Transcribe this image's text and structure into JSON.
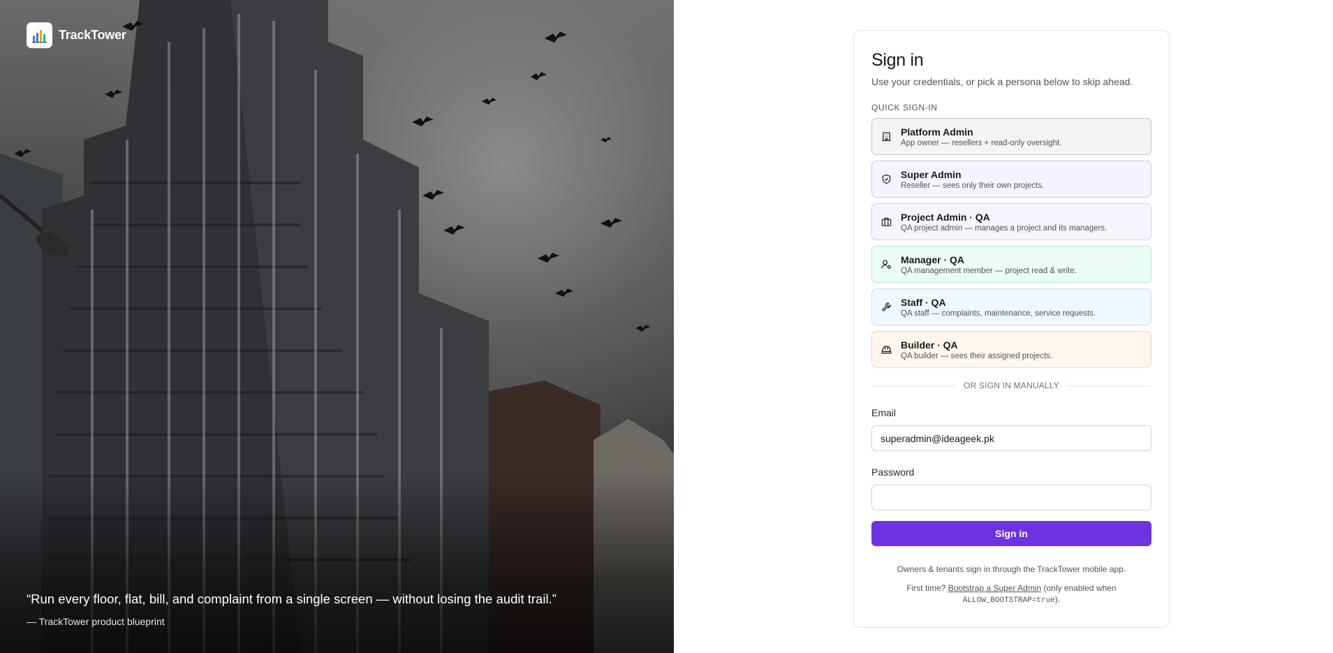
{
  "brand": {
    "name": "TrackTower",
    "logo_icon": "bar-chart-icon"
  },
  "hero": {
    "quote": "“Run every floor, flat, bill, and complaint from a single screen — without losing the audit trail.”",
    "attribution": "— TrackTower product blueprint"
  },
  "signin": {
    "title": "Sign in",
    "subtitle": "Use your credentials, or pick a persona below to skip ahead.",
    "quick_label": "QUICK SIGN-IN",
    "personas": [
      {
        "title": "Platform Admin",
        "desc": "App owner — resellers + read-only oversight.",
        "icon": "building-icon"
      },
      {
        "title": "Super Admin",
        "desc": "Reseller — sees only their own projects.",
        "icon": "shield-check-icon"
      },
      {
        "title": "Project Admin · QA",
        "desc": "QA project admin — manages a project and its managers.",
        "icon": "briefcase-icon"
      },
      {
        "title": "Manager · QA",
        "desc": "QA management member — project read & write.",
        "icon": "user-cog-icon"
      },
      {
        "title": "Staff · QA",
        "desc": "QA staff — complaints, maintenance, service requests.",
        "icon": "wrench-icon"
      },
      {
        "title": "Builder · QA",
        "desc": "QA builder — sees their assigned projects.",
        "icon": "hard-hat-icon"
      }
    ],
    "divider_text": "OR SIGN IN MANUALLY",
    "email_label": "Email",
    "email_value": "superadmin@ideageek.pk",
    "password_label": "Password",
    "password_value": "",
    "submit_label": "Sign in",
    "footnote": "Owners & tenants sign in through the TrackTower mobile app.",
    "first_time_prefix": "First time?",
    "bootstrap_link": "Bootstrap a Super Admin",
    "first_time_mid": "(only enabled when",
    "bootstrap_flag": "ALLOW_BOOTSTRAP=true",
    "first_time_suffix": ")."
  },
  "colors": {
    "accent": "#6d33e0"
  }
}
